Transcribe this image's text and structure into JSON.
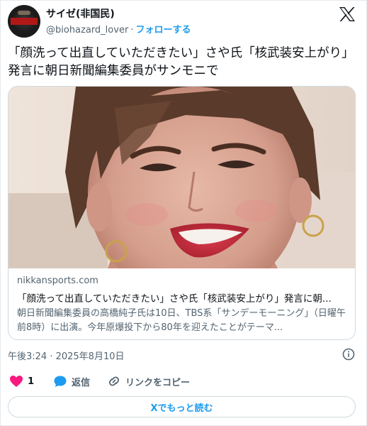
{
  "author": {
    "display_name": "サイゼ(非国民)",
    "handle": "@biohazard_lover",
    "separator": "·",
    "follow_label": "フォローする"
  },
  "tweet": {
    "text": "「顔洗って出直していただきたい」さや氏「核武装安上がり」発言に朝日新聞編集委員がサンモニで"
  },
  "link_card": {
    "domain": "nikkansports.com",
    "title": "「顔洗って出直していただきたい」さや氏「核武装安上がり」発言に朝...",
    "description": "朝日新聞編集委員の高橋純子氏は10日、TBS系「サンデーモーニング」（日曜午前8時）に出演。今年原爆投下から80年を迎えたことがテーマ..."
  },
  "timestamp": "午後3:24 · 2025年8月10日",
  "actions": {
    "like_count": "1",
    "reply_label": "返信",
    "copy_link_label": "リンクをコピー"
  },
  "read_more_label": "Xでもっと読む",
  "colors": {
    "accent": "#1d9bf0",
    "like": "#f91880",
    "text_primary": "#0f1419",
    "text_secondary": "#536471",
    "border": "#cfd9de"
  },
  "icons": [
    "x-logo-icon",
    "info-icon",
    "heart-icon",
    "reply-bubble-icon",
    "link-icon"
  ]
}
